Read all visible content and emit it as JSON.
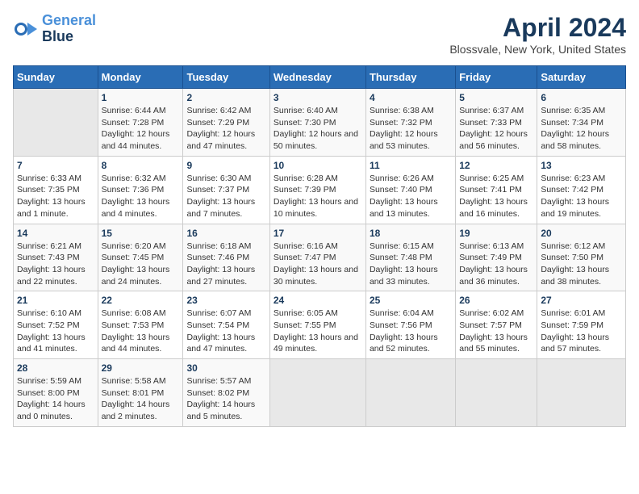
{
  "logo": {
    "line1": "General",
    "line2": "Blue",
    "arrow": "▶"
  },
  "title": "April 2024",
  "location": "Blossvale, New York, United States",
  "days_of_week": [
    "Sunday",
    "Monday",
    "Tuesday",
    "Wednesday",
    "Thursday",
    "Friday",
    "Saturday"
  ],
  "weeks": [
    [
      {
        "num": "",
        "sunrise": "",
        "sunset": "",
        "daylight": "",
        "empty": true
      },
      {
        "num": "1",
        "sunrise": "Sunrise: 6:44 AM",
        "sunset": "Sunset: 7:28 PM",
        "daylight": "Daylight: 12 hours and 44 minutes."
      },
      {
        "num": "2",
        "sunrise": "Sunrise: 6:42 AM",
        "sunset": "Sunset: 7:29 PM",
        "daylight": "Daylight: 12 hours and 47 minutes."
      },
      {
        "num": "3",
        "sunrise": "Sunrise: 6:40 AM",
        "sunset": "Sunset: 7:30 PM",
        "daylight": "Daylight: 12 hours and 50 minutes."
      },
      {
        "num": "4",
        "sunrise": "Sunrise: 6:38 AM",
        "sunset": "Sunset: 7:32 PM",
        "daylight": "Daylight: 12 hours and 53 minutes."
      },
      {
        "num": "5",
        "sunrise": "Sunrise: 6:37 AM",
        "sunset": "Sunset: 7:33 PM",
        "daylight": "Daylight: 12 hours and 56 minutes."
      },
      {
        "num": "6",
        "sunrise": "Sunrise: 6:35 AM",
        "sunset": "Sunset: 7:34 PM",
        "daylight": "Daylight: 12 hours and 58 minutes."
      }
    ],
    [
      {
        "num": "7",
        "sunrise": "Sunrise: 6:33 AM",
        "sunset": "Sunset: 7:35 PM",
        "daylight": "Daylight: 13 hours and 1 minute."
      },
      {
        "num": "8",
        "sunrise": "Sunrise: 6:32 AM",
        "sunset": "Sunset: 7:36 PM",
        "daylight": "Daylight: 13 hours and 4 minutes."
      },
      {
        "num": "9",
        "sunrise": "Sunrise: 6:30 AM",
        "sunset": "Sunset: 7:37 PM",
        "daylight": "Daylight: 13 hours and 7 minutes."
      },
      {
        "num": "10",
        "sunrise": "Sunrise: 6:28 AM",
        "sunset": "Sunset: 7:39 PM",
        "daylight": "Daylight: 13 hours and 10 minutes."
      },
      {
        "num": "11",
        "sunrise": "Sunrise: 6:26 AM",
        "sunset": "Sunset: 7:40 PM",
        "daylight": "Daylight: 13 hours and 13 minutes."
      },
      {
        "num": "12",
        "sunrise": "Sunrise: 6:25 AM",
        "sunset": "Sunset: 7:41 PM",
        "daylight": "Daylight: 13 hours and 16 minutes."
      },
      {
        "num": "13",
        "sunrise": "Sunrise: 6:23 AM",
        "sunset": "Sunset: 7:42 PM",
        "daylight": "Daylight: 13 hours and 19 minutes."
      }
    ],
    [
      {
        "num": "14",
        "sunrise": "Sunrise: 6:21 AM",
        "sunset": "Sunset: 7:43 PM",
        "daylight": "Daylight: 13 hours and 22 minutes."
      },
      {
        "num": "15",
        "sunrise": "Sunrise: 6:20 AM",
        "sunset": "Sunset: 7:45 PM",
        "daylight": "Daylight: 13 hours and 24 minutes."
      },
      {
        "num": "16",
        "sunrise": "Sunrise: 6:18 AM",
        "sunset": "Sunset: 7:46 PM",
        "daylight": "Daylight: 13 hours and 27 minutes."
      },
      {
        "num": "17",
        "sunrise": "Sunrise: 6:16 AM",
        "sunset": "Sunset: 7:47 PM",
        "daylight": "Daylight: 13 hours and 30 minutes."
      },
      {
        "num": "18",
        "sunrise": "Sunrise: 6:15 AM",
        "sunset": "Sunset: 7:48 PM",
        "daylight": "Daylight: 13 hours and 33 minutes."
      },
      {
        "num": "19",
        "sunrise": "Sunrise: 6:13 AM",
        "sunset": "Sunset: 7:49 PM",
        "daylight": "Daylight: 13 hours and 36 minutes."
      },
      {
        "num": "20",
        "sunrise": "Sunrise: 6:12 AM",
        "sunset": "Sunset: 7:50 PM",
        "daylight": "Daylight: 13 hours and 38 minutes."
      }
    ],
    [
      {
        "num": "21",
        "sunrise": "Sunrise: 6:10 AM",
        "sunset": "Sunset: 7:52 PM",
        "daylight": "Daylight: 13 hours and 41 minutes."
      },
      {
        "num": "22",
        "sunrise": "Sunrise: 6:08 AM",
        "sunset": "Sunset: 7:53 PM",
        "daylight": "Daylight: 13 hours and 44 minutes."
      },
      {
        "num": "23",
        "sunrise": "Sunrise: 6:07 AM",
        "sunset": "Sunset: 7:54 PM",
        "daylight": "Daylight: 13 hours and 47 minutes."
      },
      {
        "num": "24",
        "sunrise": "Sunrise: 6:05 AM",
        "sunset": "Sunset: 7:55 PM",
        "daylight": "Daylight: 13 hours and 49 minutes."
      },
      {
        "num": "25",
        "sunrise": "Sunrise: 6:04 AM",
        "sunset": "Sunset: 7:56 PM",
        "daylight": "Daylight: 13 hours and 52 minutes."
      },
      {
        "num": "26",
        "sunrise": "Sunrise: 6:02 AM",
        "sunset": "Sunset: 7:57 PM",
        "daylight": "Daylight: 13 hours and 55 minutes."
      },
      {
        "num": "27",
        "sunrise": "Sunrise: 6:01 AM",
        "sunset": "Sunset: 7:59 PM",
        "daylight": "Daylight: 13 hours and 57 minutes."
      }
    ],
    [
      {
        "num": "28",
        "sunrise": "Sunrise: 5:59 AM",
        "sunset": "Sunset: 8:00 PM",
        "daylight": "Daylight: 14 hours and 0 minutes."
      },
      {
        "num": "29",
        "sunrise": "Sunrise: 5:58 AM",
        "sunset": "Sunset: 8:01 PM",
        "daylight": "Daylight: 14 hours and 2 minutes."
      },
      {
        "num": "30",
        "sunrise": "Sunrise: 5:57 AM",
        "sunset": "Sunset: 8:02 PM",
        "daylight": "Daylight: 14 hours and 5 minutes."
      },
      {
        "num": "",
        "sunrise": "",
        "sunset": "",
        "daylight": "",
        "empty": true
      },
      {
        "num": "",
        "sunrise": "",
        "sunset": "",
        "daylight": "",
        "empty": true
      },
      {
        "num": "",
        "sunrise": "",
        "sunset": "",
        "daylight": "",
        "empty": true
      },
      {
        "num": "",
        "sunrise": "",
        "sunset": "",
        "daylight": "",
        "empty": true
      }
    ]
  ]
}
